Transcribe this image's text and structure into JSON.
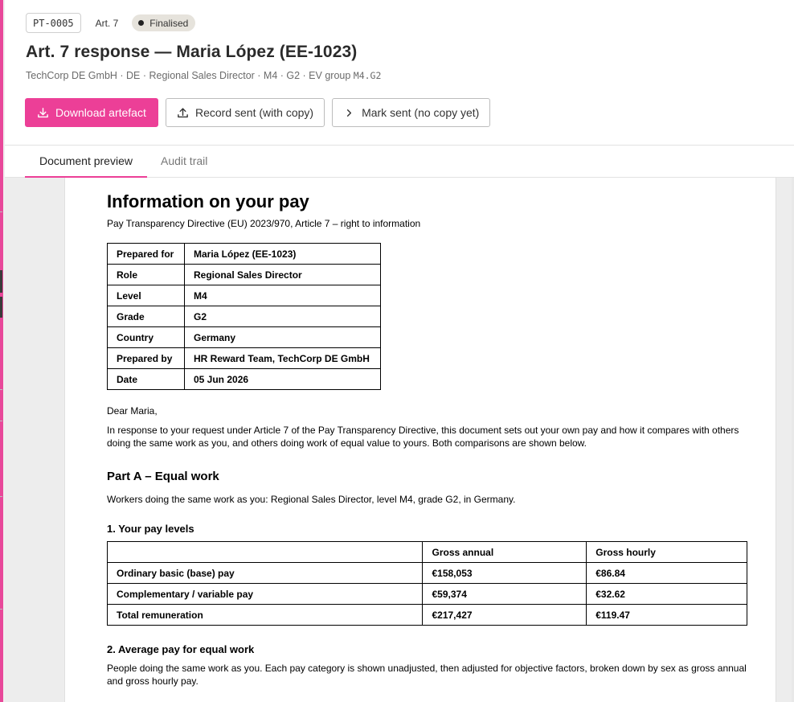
{
  "header": {
    "id_chip": "PT-0005",
    "article_chip": "Art. 7",
    "status_chip": "Finalised",
    "title": "Art. 7 response — Maria López (EE-1023)",
    "subtitle_text": "TechCorp DE GmbH · DE · Regional Sales Director · M4 · G2 · EV group ",
    "subtitle_code": "M4.G2"
  },
  "actions": {
    "download": "Download artefact",
    "record_sent": "Record sent (with copy)",
    "mark_sent": "Mark sent (no copy yet)"
  },
  "tabs": [
    {
      "label": "Document preview",
      "active": true
    },
    {
      "label": "Audit trail",
      "active": false
    }
  ],
  "doc": {
    "title": "Information on your pay",
    "lead": "Pay Transparency Directive (EU) 2023/970, Article 7 – right to information",
    "info_rows": [
      {
        "k": "Prepared for",
        "v": "Maria López (EE-1023)"
      },
      {
        "k": "Role",
        "v": "Regional Sales Director"
      },
      {
        "k": "Level",
        "v": "M4"
      },
      {
        "k": "Grade",
        "v": "G2"
      },
      {
        "k": "Country",
        "v": "Germany"
      },
      {
        "k": "Prepared by",
        "v": "HR Reward Team, TechCorp DE GmbH"
      },
      {
        "k": "Date",
        "v": "05 Jun 2026"
      }
    ],
    "greeting": "Dear Maria,",
    "intro": "In response to your request under Article 7 of the Pay Transparency Directive, this document sets out your own pay and how it compares with others doing the same work as you, and others doing work of equal value to yours. Both comparisons are shown below.",
    "part_a_title": "Part A – Equal work",
    "part_a_desc": "Workers doing the same work as you: Regional Sales Director, level M4, grade G2, in Germany.",
    "section1_title": "1. Your pay levels",
    "pay_table": {
      "headers": [
        "",
        "Gross annual",
        "Gross hourly"
      ],
      "rows": [
        [
          "Ordinary basic (base) pay",
          "€158,053",
          "€86.84"
        ],
        [
          "Complementary / variable pay",
          "€59,374",
          "€32.62"
        ],
        [
          "Total remuneration",
          "€217,427",
          "€119.47"
        ]
      ]
    },
    "section2_title": "2. Average pay for equal work",
    "section2_desc": "People doing the same work as you. Each pay category is shown unadjusted, then adjusted for objective factors, broken down by sex as gross annual and gross hourly pay."
  },
  "colors": {
    "accent": "#ec3f97",
    "status_chip_bg": "#e6e3dc"
  }
}
